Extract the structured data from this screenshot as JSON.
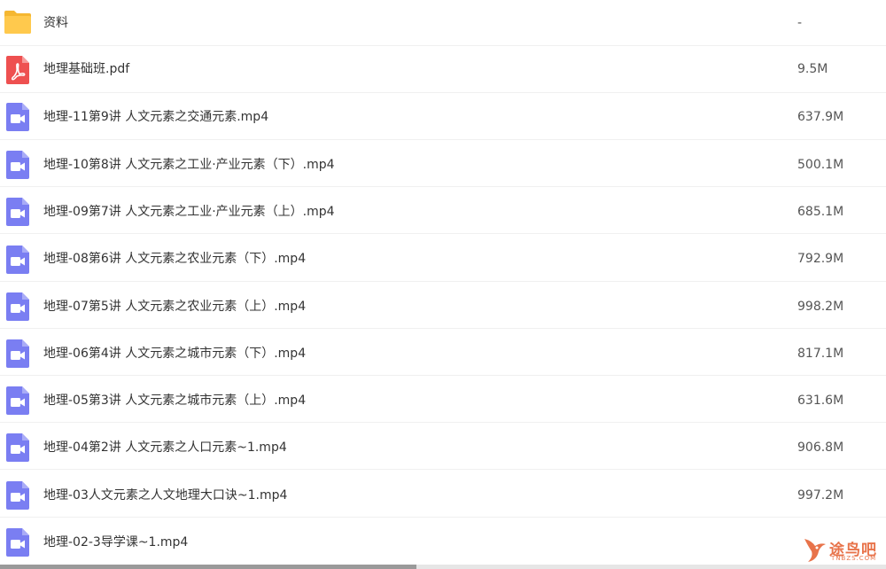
{
  "files": [
    {
      "name": "资料",
      "size": "-",
      "icon": "folder-icon"
    },
    {
      "name": "地理基础班.pdf",
      "size": "9.5M",
      "icon": "pdf-file-icon"
    },
    {
      "name": "地理-11第9讲 人文元素之交通元素.mp4",
      "size": "637.9M",
      "icon": "video-file-icon"
    },
    {
      "name": "地理-10第8讲 人文元素之工业·产业元素（下）.mp4",
      "size": "500.1M",
      "icon": "video-file-icon"
    },
    {
      "name": "地理-09第7讲 人文元素之工业·产业元素（上）.mp4",
      "size": "685.1M",
      "icon": "video-file-icon"
    },
    {
      "name": "地理-08第6讲 人文元素之农业元素（下）.mp4",
      "size": "792.9M",
      "icon": "video-file-icon"
    },
    {
      "name": "地理-07第5讲 人文元素之农业元素（上）.mp4",
      "size": "998.2M",
      "icon": "video-file-icon"
    },
    {
      "name": "地理-06第4讲 人文元素之城市元素（下）.mp4",
      "size": "817.1M",
      "icon": "video-file-icon"
    },
    {
      "name": "地理-05第3讲 人文元素之城市元素（上）.mp4",
      "size": "631.6M",
      "icon": "video-file-icon"
    },
    {
      "name": "地理-04第2讲 人文元素之人口元素~1.mp4",
      "size": "906.8M",
      "icon": "video-file-icon"
    },
    {
      "name": "地理-03人文元素之人文地理大口诀~1.mp4",
      "size": "997.2M",
      "icon": "video-file-icon"
    },
    {
      "name": "地理-02-3导学课~1.mp4",
      "size": "",
      "icon": "video-file-icon"
    }
  ],
  "colors": {
    "folder": "#FFC94D",
    "folder_tab": "#F5B731",
    "pdf": "#EE5050",
    "video": "#7A7EF2",
    "watermark": "#E8734A"
  },
  "watermark": {
    "text": "途鸟吧",
    "sub": "TNBZS.COM"
  }
}
